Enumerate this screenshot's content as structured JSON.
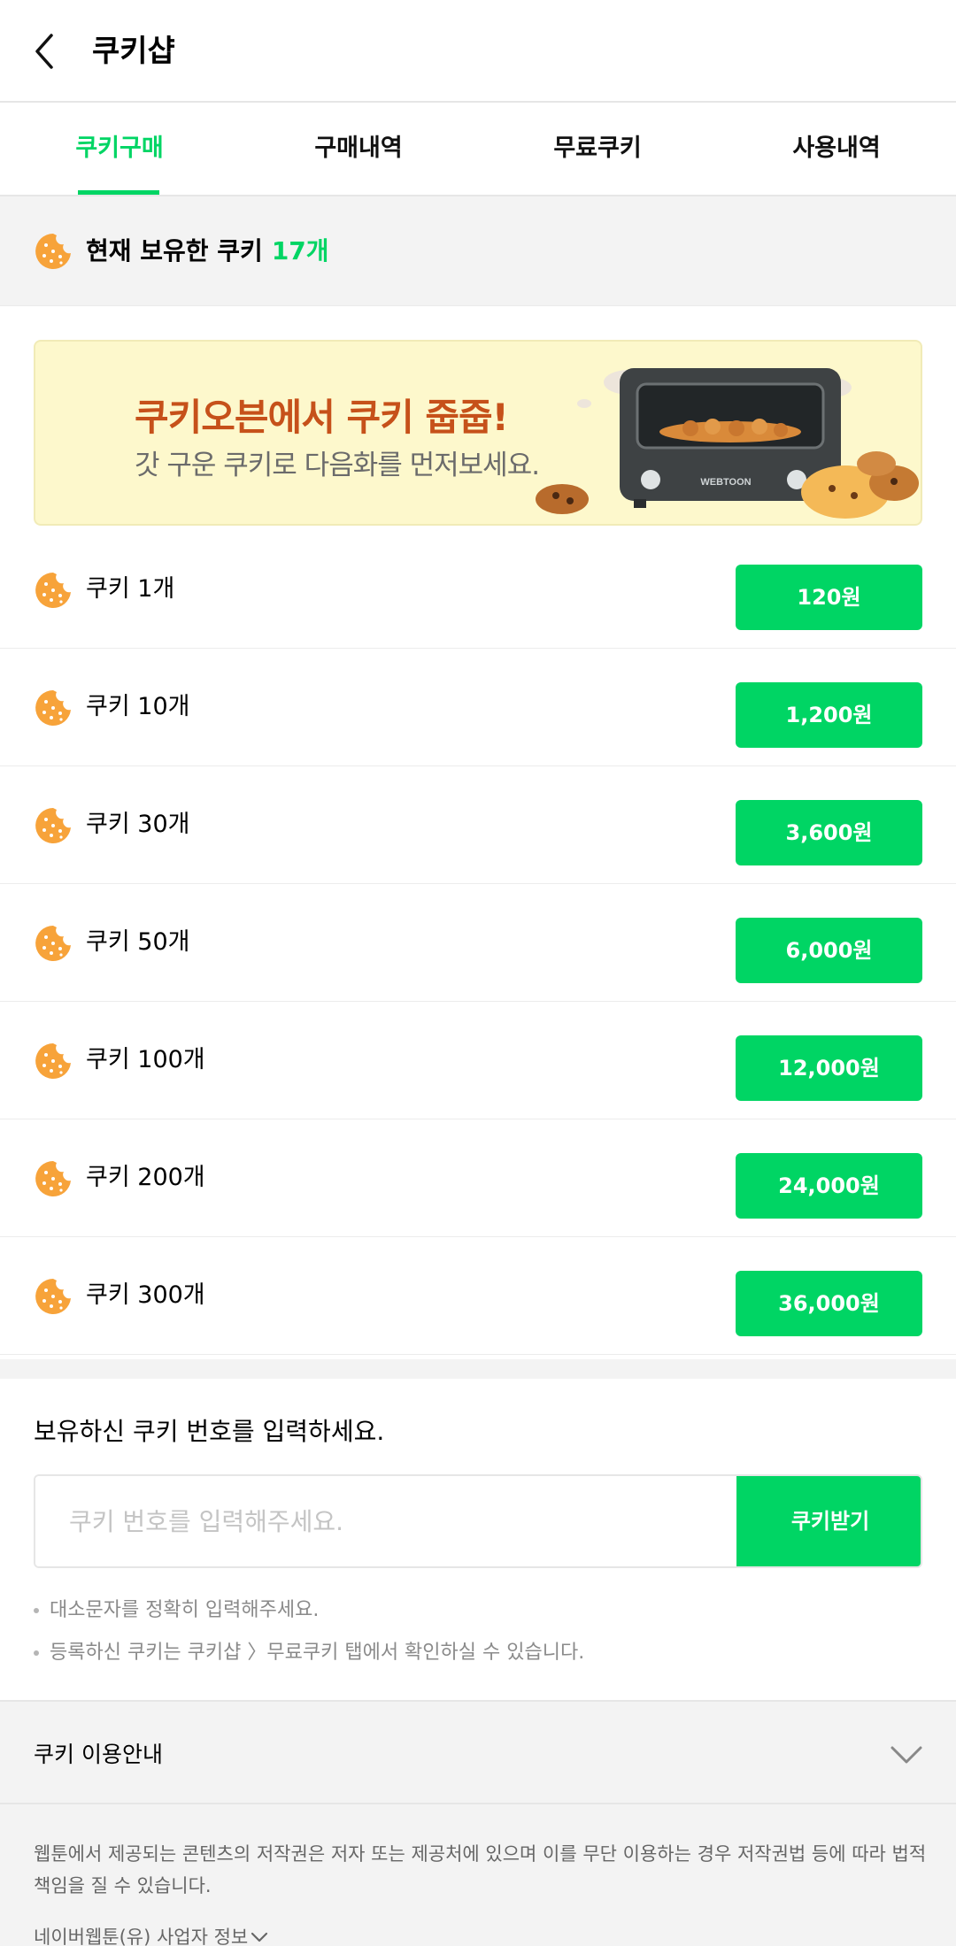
{
  "header": {
    "title": "쿠키샵"
  },
  "tabs": [
    {
      "label": "쿠키구매",
      "active": true
    },
    {
      "label": "구매내역",
      "active": false
    },
    {
      "label": "무료쿠키",
      "active": false
    },
    {
      "label": "사용내역",
      "active": false
    }
  ],
  "owned": {
    "label": "현재 보유한 쿠키",
    "count": "17개"
  },
  "banner": {
    "title": "쿠키오븐에서 쿠키 줍줍!",
    "subtitle": "갓 구운 쿠키로 다음화를 먼저보세요.",
    "oven_text": "WEBTOON"
  },
  "products": [
    {
      "name": "쿠키 1개",
      "price": "120원"
    },
    {
      "name": "쿠키 10개",
      "price": "1,200원"
    },
    {
      "name": "쿠키 30개",
      "price": "3,600원"
    },
    {
      "name": "쿠키 50개",
      "price": "6,000원"
    },
    {
      "name": "쿠키 100개",
      "price": "12,000원"
    },
    {
      "name": "쿠키 200개",
      "price": "24,000원"
    },
    {
      "name": "쿠키 300개",
      "price": "36,000원"
    }
  ],
  "code": {
    "title": "보유하신 쿠키 번호를 입력하세요.",
    "placeholder": "쿠키 번호를 입력해주세요.",
    "button": "쿠키받기"
  },
  "notes": [
    "대소문자를 정확히 입력해주세요.",
    "등록하신 쿠키는 쿠키샵 〉무료쿠키 탭에서 확인하실 수 있습니다."
  ],
  "guide": {
    "label": "쿠키 이용안내"
  },
  "footer": {
    "copyright": "웹툰에서 제공되는 콘텐츠의 저작권은 저자 또는 제공처에 있으며 이를 무단 이용하는 경우 저작권법 등에 따라 법적책임을 질 수 있습니다.",
    "business": "네이버웹툰(유) 사업자 정보"
  },
  "colors": {
    "accent": "#00d564",
    "cookie": "#f7a33a",
    "banner_title": "#c6511a",
    "banner_bg": "#fdf8cc"
  },
  "icons": [
    "back-arrow-icon",
    "cookie-icon",
    "chevron-down-icon"
  ]
}
